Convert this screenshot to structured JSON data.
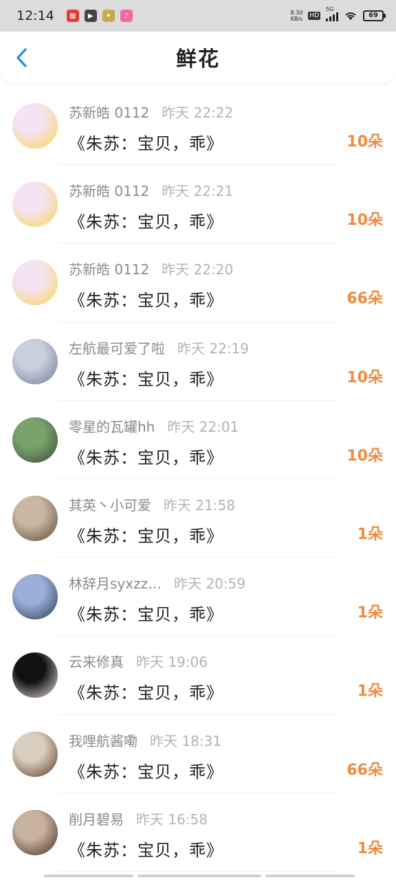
{
  "status_bar": {
    "time": "12:14",
    "net_speed_value": "8.30",
    "net_speed_unit": "KB/s",
    "hd": "HD",
    "signal_tag": "5G",
    "battery": "69"
  },
  "header": {
    "title": "鲜花",
    "back_icon": "chevron-left-icon"
  },
  "items": [
    {
      "name": "苏新皓 0112",
      "time": "昨天 22:22",
      "title": "《朱苏：宝贝，乖》",
      "count": "10朵",
      "avatar_colors": [
        "#f5e2f3",
        "#fbd64b"
      ]
    },
    {
      "name": "苏新皓 0112",
      "time": "昨天 22:21",
      "title": "《朱苏：宝贝，乖》",
      "count": "10朵",
      "avatar_colors": [
        "#f5e2f3",
        "#fbd64b"
      ]
    },
    {
      "name": "苏新皓 0112",
      "time": "昨天 22:20",
      "title": "《朱苏：宝贝，乖》",
      "count": "66朵",
      "avatar_colors": [
        "#f5e2f3",
        "#fbd64b"
      ]
    },
    {
      "name": "左航最可爱了啦",
      "time": "昨天 22:19",
      "title": "《朱苏：宝贝，乖》",
      "count": "10朵",
      "avatar_colors": [
        "#c8d0de",
        "#6f7b93"
      ]
    },
    {
      "name": "零星的瓦罐hh",
      "time": "昨天 22:01",
      "title": "《朱苏：宝贝，乖》",
      "count": "10朵",
      "avatar_colors": [
        "#7aa36b",
        "#3a4a3a"
      ]
    },
    {
      "name": "其英丶小可爱",
      "time": "昨天 21:58",
      "title": "《朱苏：宝贝，乖》",
      "count": "1朵",
      "avatar_colors": [
        "#c9b7a3",
        "#5a463a"
      ]
    },
    {
      "name": "林辞月syxzz…",
      "time": "昨天 20:59",
      "title": "《朱苏：宝贝，乖》",
      "count": "1朵",
      "avatar_colors": [
        "#9ab0d8",
        "#2d3a55"
      ]
    },
    {
      "name": "云来修真",
      "time": "昨天 19:06",
      "title": "《朱苏：宝贝，乖》",
      "count": "1朵",
      "avatar_colors": [
        "#111111",
        "#e9e0db"
      ]
    },
    {
      "name": "我哩航酱嘞",
      "time": "昨天 18:31",
      "title": "《朱苏：宝贝，乖》",
      "count": "66朵",
      "avatar_colors": [
        "#d9cdbf",
        "#5e3a22"
      ]
    },
    {
      "name": "削月碧易",
      "time": "昨天 16:58",
      "title": "《朱苏：宝贝，乖》",
      "count": "1朵",
      "avatar_colors": [
        "#c7b2a0",
        "#4d2b26"
      ]
    }
  ]
}
